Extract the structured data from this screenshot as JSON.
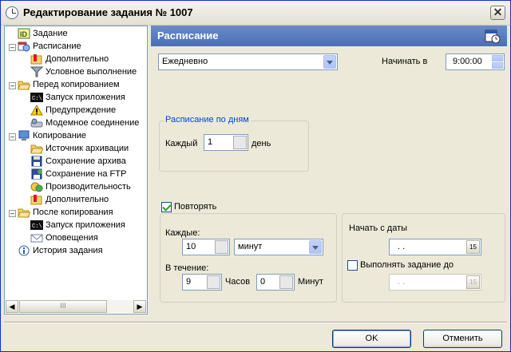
{
  "window": {
    "title": "Редактирование задания № 1007"
  },
  "tree": {
    "items": [
      {
        "label": "Задание",
        "icon": "id-card-icon"
      },
      {
        "label": "Расписание",
        "icon": "schedule-icon"
      },
      {
        "label": "Дополнительно",
        "icon": "folder-options-icon"
      },
      {
        "label": "Условное выполнение",
        "icon": "filter-icon"
      },
      {
        "label": "Перед копированием",
        "icon": "open-folder-icon"
      },
      {
        "label": "Запуск приложения",
        "icon": "console-icon"
      },
      {
        "label": "Предупреждение",
        "icon": "warning-icon"
      },
      {
        "label": "Модемное соединение",
        "icon": "modem-icon"
      },
      {
        "label": "Копирование",
        "icon": "computer-icon"
      },
      {
        "label": "Источник архивации",
        "icon": "folder-icon"
      },
      {
        "label": "Сохранение архива",
        "icon": "floppy-icon"
      },
      {
        "label": "Сохранение на FTP",
        "icon": "ftp-icon"
      },
      {
        "label": "Производительность",
        "icon": "performance-icon"
      },
      {
        "label": "Дополнительно",
        "icon": "folder-options-icon"
      },
      {
        "label": "После копирования",
        "icon": "open-folder-icon"
      },
      {
        "label": "Запуск приложения",
        "icon": "console-icon"
      },
      {
        "label": "Оповещения",
        "icon": "envelope-icon"
      },
      {
        "label": "История задания",
        "icon": "info-icon"
      }
    ],
    "scroll_thumb": "III"
  },
  "panel": {
    "title": "Расписание",
    "frequency": "Ежедневно",
    "start_at_label": "Начинать в",
    "start_time": "9:00:00",
    "by_days_group": "Расписание по дням",
    "every_label": "Каждый",
    "every_value": "1",
    "day_unit": "день",
    "repeat_label": "Повторять",
    "repeat_checked": true,
    "each_label": "Каждые:",
    "each_value": "10",
    "each_unit": "минут",
    "during_label": "В течение:",
    "hours_value": "9",
    "hours_label": "Часов",
    "minutes_value": "0",
    "minutes_label": "Минут",
    "start_date_label": "Начать с даты",
    "start_date_value": ". .",
    "run_until_label": "Выполнять задание до",
    "run_until_checked": false,
    "run_until_value": ". ."
  },
  "buttons": {
    "ok": "OK",
    "cancel": "Отменить"
  }
}
